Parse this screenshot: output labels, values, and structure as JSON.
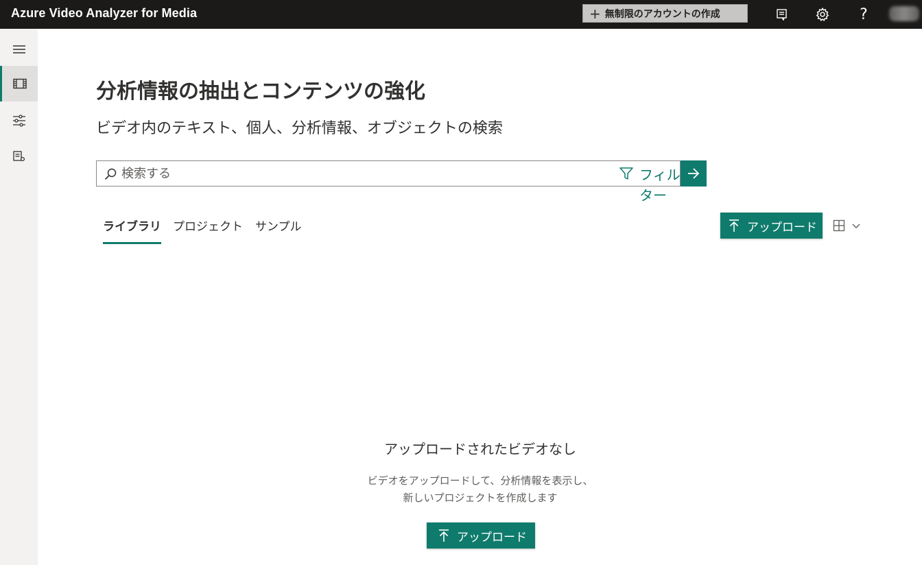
{
  "header": {
    "app_title": "Azure Video Analyzer for Media",
    "create_account_label": "無制限のアカウントの作成",
    "icons": [
      "feedback-icon",
      "gear-icon",
      "help-icon",
      "avatar"
    ],
    "help_glyph": "?"
  },
  "sidebar": {
    "items": [
      {
        "name": "hamburger-menu-icon"
      },
      {
        "name": "media-library-icon",
        "active": true
      },
      {
        "name": "model-customization-icon"
      },
      {
        "name": "account-settings-icon"
      }
    ]
  },
  "main": {
    "title": "分析情報の抽出とコンテンツの強化",
    "subtitle": "ビデオ内のテキスト、個人、分析情報、オブジェクトの検索",
    "search": {
      "placeholder": "検索する",
      "filter_label": "フィルター"
    },
    "tabs": [
      {
        "label": "ライブラリ",
        "active": true
      },
      {
        "label": "プロジェクト",
        "active": false
      },
      {
        "label": "サンプル",
        "active": false
      }
    ],
    "upload_label": "アップロード"
  },
  "empty_state": {
    "title": "アップロードされたビデオなし",
    "description_line1": "ビデオをアップロードして、分析情報を表示し、",
    "description_line2": "新しいプロジェクトを作成します",
    "upload_label": "アップロード"
  },
  "colors": {
    "accent": "#0f7b6c",
    "topbar": "#1b1a19",
    "rail": "#f3f2f1"
  }
}
